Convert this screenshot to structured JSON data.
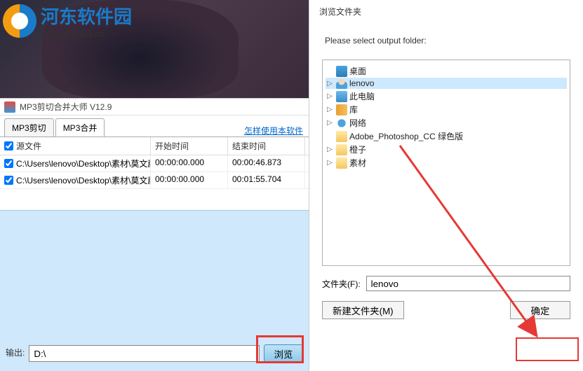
{
  "watermark": {
    "title": "河东软件园",
    "url": "www.pc0359.cn"
  },
  "leftApp": {
    "title": "MP3剪切合并大师 V12.9",
    "tabs": [
      "MP3剪切",
      "MP3合并"
    ],
    "activeTab": 1,
    "helpLink": "怎样使用本软件",
    "columns": [
      "源文件",
      "开始时间",
      "结束时间"
    ],
    "rows": [
      {
        "file": "C:\\Users\\lenovo\\Desktop\\素材\\莫文蔚 -...",
        "start": "00:00:00.000",
        "end": "00:00:46.873"
      },
      {
        "file": "C:\\Users\\lenovo\\Desktop\\素材\\莫文蔚 -...",
        "start": "00:00:00.000",
        "end": "00:01:55.704"
      }
    ],
    "outputLabel": "输出:",
    "outputPath": "D:\\",
    "browseLabel": "浏览"
  },
  "dialog": {
    "title": "浏览文件夹",
    "instruction": "Please select output folder:",
    "tree": {
      "root": "桌面",
      "selected": "lenovo",
      "items": [
        {
          "label": "lenovo",
          "icon": "user",
          "expandable": true
        },
        {
          "label": "此电脑",
          "icon": "pc",
          "expandable": true
        },
        {
          "label": "库",
          "icon": "lib",
          "expandable": true
        },
        {
          "label": "网络",
          "icon": "net",
          "expandable": true
        },
        {
          "label": "Adobe_Photoshop_CC  绿色版",
          "icon": "folder",
          "expandable": false
        },
        {
          "label": "橙子",
          "icon": "folder",
          "expandable": true
        },
        {
          "label": "素材",
          "icon": "folder",
          "expandable": true
        }
      ]
    },
    "folderLabel": "文件夹(F):",
    "folderValue": "lenovo",
    "newFolderBtn": "新建文件夹(M)",
    "okBtn": "确定"
  }
}
